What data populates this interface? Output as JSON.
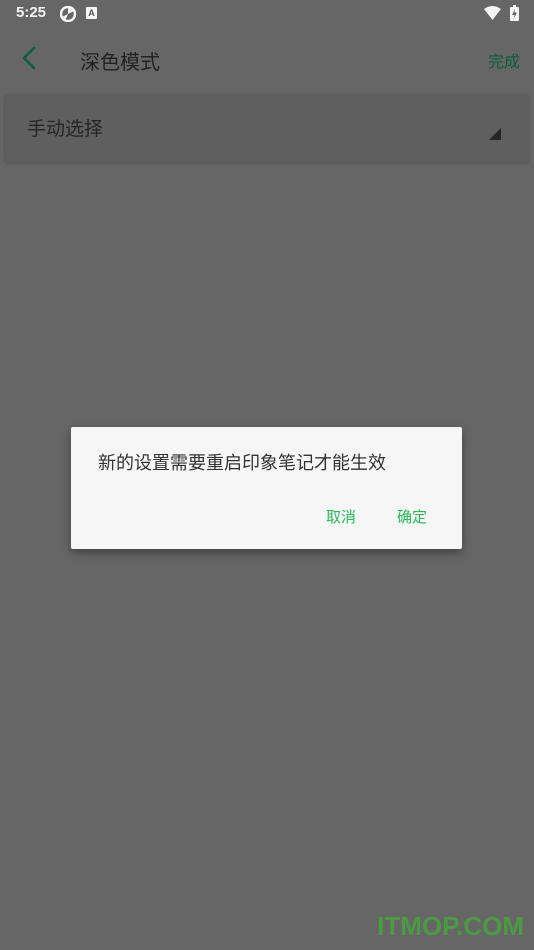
{
  "status_bar": {
    "time": "5:25",
    "icons": [
      "fan-icon",
      "a-badge-icon",
      "wifi-icon",
      "battery-charging-icon"
    ],
    "a_badge_text": "A"
  },
  "toolbar": {
    "back_icon": "chevron-left-icon",
    "title": "深色模式",
    "done_label": "完成"
  },
  "select": {
    "value": "手动选择",
    "arrow_icon": "dropdown-triangle-icon"
  },
  "dialog": {
    "message": "新的设置需要重启印象笔记才能生效",
    "cancel_label": "取消",
    "confirm_label": "确定"
  },
  "watermark": {
    "text": "ITMOP.COM"
  },
  "colors": {
    "accent_green": "#2bb85a",
    "dark_green": "#0a5f3a",
    "overlay_bg": "#666666",
    "dialog_bg": "#f6f6f6"
  }
}
